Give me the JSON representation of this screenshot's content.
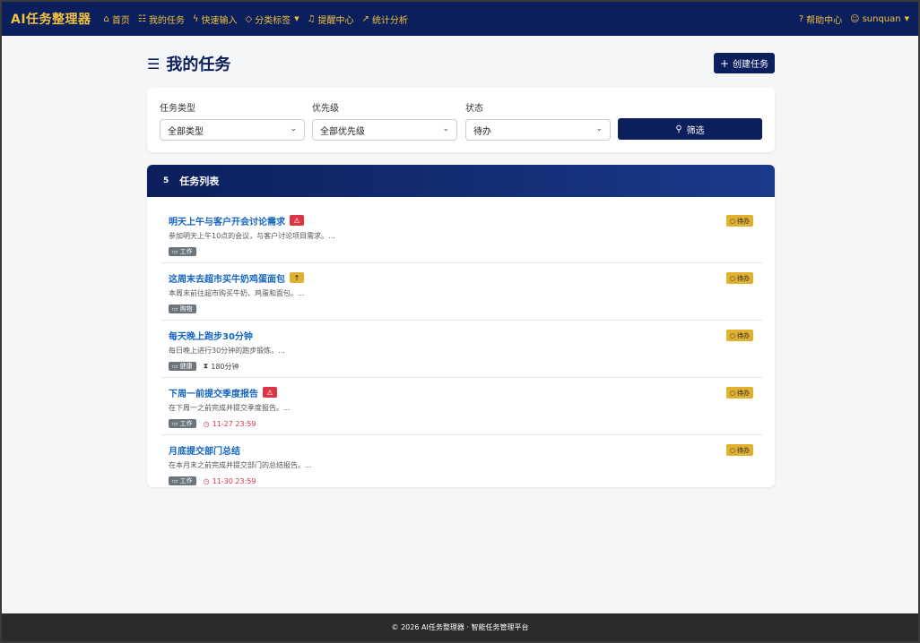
{
  "navbar": {
    "brand": "AI任务整理器",
    "items": [
      {
        "icon": "home-icon",
        "glyph": "⌂",
        "label": "首页"
      },
      {
        "icon": "list-icon",
        "glyph": "☷",
        "label": "我的任务"
      },
      {
        "icon": "bolt-icon",
        "glyph": "ϟ",
        "label": "快速输入"
      },
      {
        "icon": "tag-icon",
        "glyph": "⌂",
        "label": "分类标签"
      },
      {
        "icon": "bell-icon",
        "glyph": "♫",
        "label": "提醒中心"
      },
      {
        "icon": "chart-line-icon",
        "glyph": "↗",
        "label": "统计分析"
      }
    ],
    "help": "帮助中心",
    "user": "sunquan"
  },
  "page": {
    "title": "我的任务",
    "create_label": "创建任务"
  },
  "filters": {
    "type_label": "任务类型",
    "type_value": "全部类型",
    "priority_label": "优先级",
    "priority_value": "全部优先级",
    "status_label": "状态",
    "status_value": "待办",
    "filter_label": "筛选"
  },
  "task_list": {
    "count": "5",
    "title": "任务列表",
    "tasks": [
      {
        "title": "明天上午与客户开会讨论需求",
        "priority": "high",
        "desc": "参加明天上午10点的会议，与客户讨论项目需求。...",
        "tag": "工作",
        "extra": "",
        "status": "待办"
      },
      {
        "title": "这周末去超市买牛奶鸡蛋面包",
        "priority": "mid",
        "desc": "本周末前往超市购买牛奶、鸡蛋和面包。...",
        "tag": "购物",
        "extra": "",
        "status": "待办"
      },
      {
        "title": "每天晚上跑步30分钟",
        "priority": "",
        "desc": "每日晚上进行30分钟的跑步锻炼。...",
        "tag": "健康",
        "extra": "180分钟",
        "status": "待办"
      },
      {
        "title": "下周一前提交季度报告",
        "priority": "high",
        "desc": "在下周一之前完成并提交季度报告。...",
        "tag": "工作",
        "extra": "11-27 23:59",
        "status": "待办"
      },
      {
        "title": "月底提交部门总结",
        "priority": "",
        "desc": "在本月末之前完成并提交部门的总结报告。...",
        "tag": "工作",
        "extra": "11-30 23:59",
        "status": "待办"
      }
    ]
  },
  "footer": "© 2026 AI任务整理器 · 智能任务管理平台"
}
